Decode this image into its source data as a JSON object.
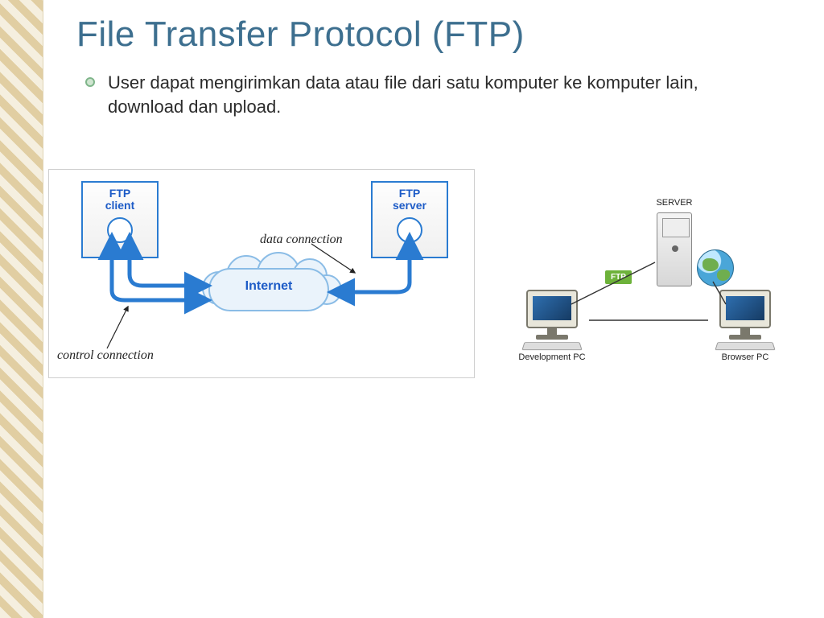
{
  "slide": {
    "title": "File Transfer Protocol (FTP)",
    "bullet": "User dapat mengirimkan data atau file dari satu komputer ke komputer lain, download dan upload."
  },
  "diagram1": {
    "client": "FTP\nclient",
    "server": "FTP\nserver",
    "cloud": "Internet",
    "data_connection": "data connection",
    "control_connection": "control connection"
  },
  "diagram2": {
    "server": "SERVER",
    "ftp_badge": "FTP",
    "development_pc": "Development PC",
    "browser_pc": "Browser PC"
  }
}
